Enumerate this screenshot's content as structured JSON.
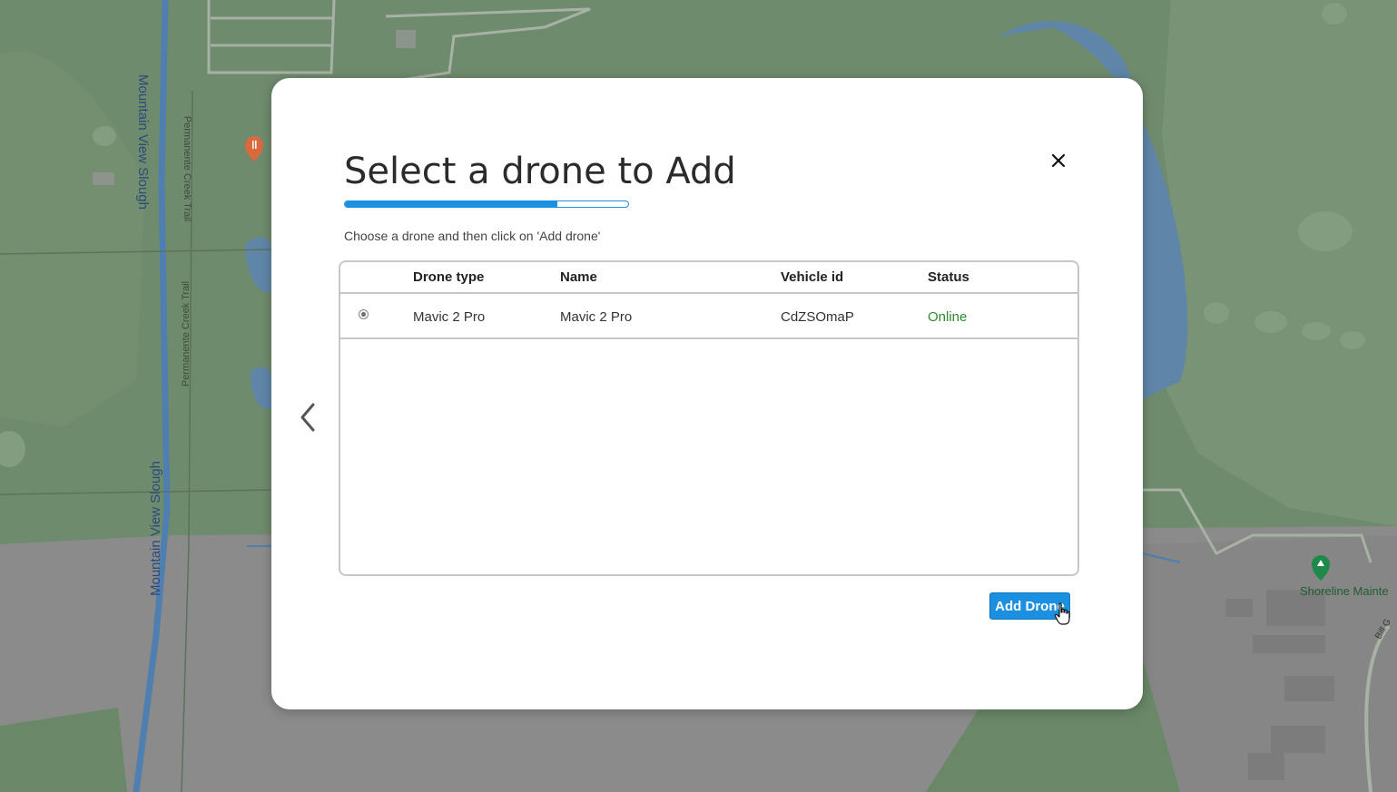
{
  "map": {
    "labels": {
      "slough_top": "Mountain View Slough",
      "slough_bottom": "Mountain View Slough",
      "trail_top": "Permanente Creek Trail",
      "trail_bottom": "Permanente Creek Trail",
      "poi": "Shoreline Mainte",
      "road": "Bill G"
    },
    "icons": [
      "restaurant-pin-icon",
      "park-pin-icon"
    ]
  },
  "modal": {
    "title": "Select a drone to Add",
    "progress_fraction": 0.75,
    "subtitle": "Choose a drone and then click on 'Add drone'",
    "columns": {
      "drone_type": "Drone type",
      "name": "Name",
      "vehicle_id": "Vehicle id",
      "status": "Status"
    },
    "rows": [
      {
        "selected": true,
        "drone_type": "Mavic 2 Pro",
        "name": "Mavic 2 Pro",
        "vehicle_id": "CdZSOmaP",
        "status": "Online"
      }
    ],
    "add_button_label": "Add Drone",
    "icons": {
      "close": "close-icon",
      "back": "chevron-left-icon"
    }
  },
  "colors": {
    "accent": "#1b8fe0",
    "status_online": "#2e8b2e"
  }
}
